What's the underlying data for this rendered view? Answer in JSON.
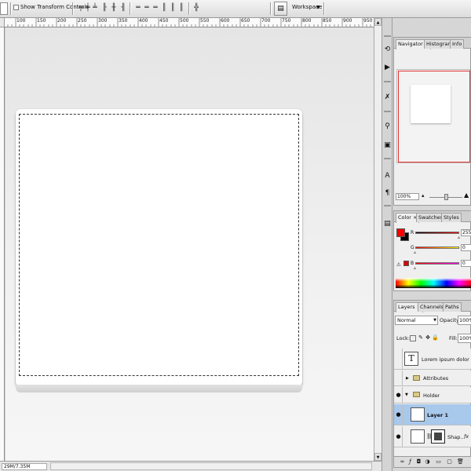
{
  "options_bar": {
    "show_transform_controls": "Show Transform Controls",
    "workspace": "Workspace",
    "icons": [
      "align-top-edges-icon",
      "align-vertical-centers-icon",
      "align-bottom-edges-icon",
      "align-left-edges-icon",
      "align-horizontal-centers-icon",
      "align-right-edges-icon",
      "distribute-top-icon",
      "distribute-vertical-center-icon",
      "distribute-bottom-icon",
      "distribute-left-icon",
      "distribute-horizontal-center-icon",
      "distribute-right-icon",
      "auto-align-icon"
    ]
  },
  "ruler": {
    "labels": [
      "100",
      "150",
      "200",
      "250",
      "300",
      "350",
      "400",
      "450",
      "500",
      "550",
      "600",
      "650",
      "700",
      "750",
      "800",
      "850",
      "900",
      "950"
    ]
  },
  "status_bar": {
    "doc_info": "29M/7.35M"
  },
  "navigator_panel": {
    "tabs": [
      "Navigator ×",
      "Histogram",
      "Info"
    ],
    "zoom": "100%"
  },
  "color_panel": {
    "tabs": [
      "Color ×",
      "Swatches",
      "Styles"
    ],
    "foreground": "#ff0000",
    "background": "#000000",
    "channels": [
      {
        "label": "R",
        "value": "255"
      },
      {
        "label": "G",
        "value": "0"
      },
      {
        "label": "B",
        "value": "0"
      }
    ]
  },
  "layers_panel": {
    "tabs": [
      "Layers ×",
      "Channels",
      "Paths"
    ],
    "blend_mode": "Normal",
    "opacity_label": "Opacity:",
    "opacity": "100%",
    "lock_label": "Lock:",
    "fill_label": "Fill:",
    "fill": "100%",
    "layers": [
      {
        "name": "Lorem ipsum dolor sit a...",
        "kind": "text"
      },
      {
        "name": "Attributes",
        "kind": "group"
      },
      {
        "name": "Holder",
        "kind": "group"
      },
      {
        "name": "Layer 1",
        "kind": "layer",
        "selected": true
      },
      {
        "name": "Shap...",
        "kind": "shape",
        "fx": "fx"
      }
    ]
  },
  "colors": {
    "selection": "#a8c8ec",
    "navigator_box": "#e23030"
  }
}
